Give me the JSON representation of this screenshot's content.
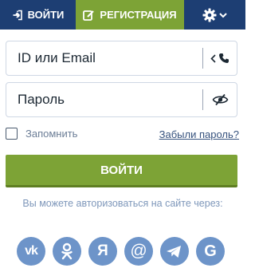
{
  "tabs": {
    "login_label": "ВОЙТИ",
    "register_label": "РЕГИСТРАЦИЯ"
  },
  "form": {
    "login_placeholder": "ID или Email",
    "password_placeholder": "Пароль",
    "remember_label": "Запомнить",
    "forgot_label": "Забыли пароль?",
    "submit_label": "ВОЙТИ"
  },
  "social": {
    "hint": "Вы можете авторизоваться на сайте через:",
    "networks": [
      {
        "icon": "vk-icon",
        "glyph": "vk"
      },
      {
        "icon": "odnoklassniki-icon",
        "glyph": ""
      },
      {
        "icon": "yandex-icon",
        "glyph": "Я"
      },
      {
        "icon": "mail-icon",
        "glyph": "@"
      },
      {
        "icon": "telegram-icon",
        "glyph": ""
      },
      {
        "icon": "google-icon",
        "glyph": "G"
      }
    ]
  },
  "colors": {
    "navy": "#1d3e73",
    "green": "#7da336",
    "social_blue": "#6d94c9"
  }
}
